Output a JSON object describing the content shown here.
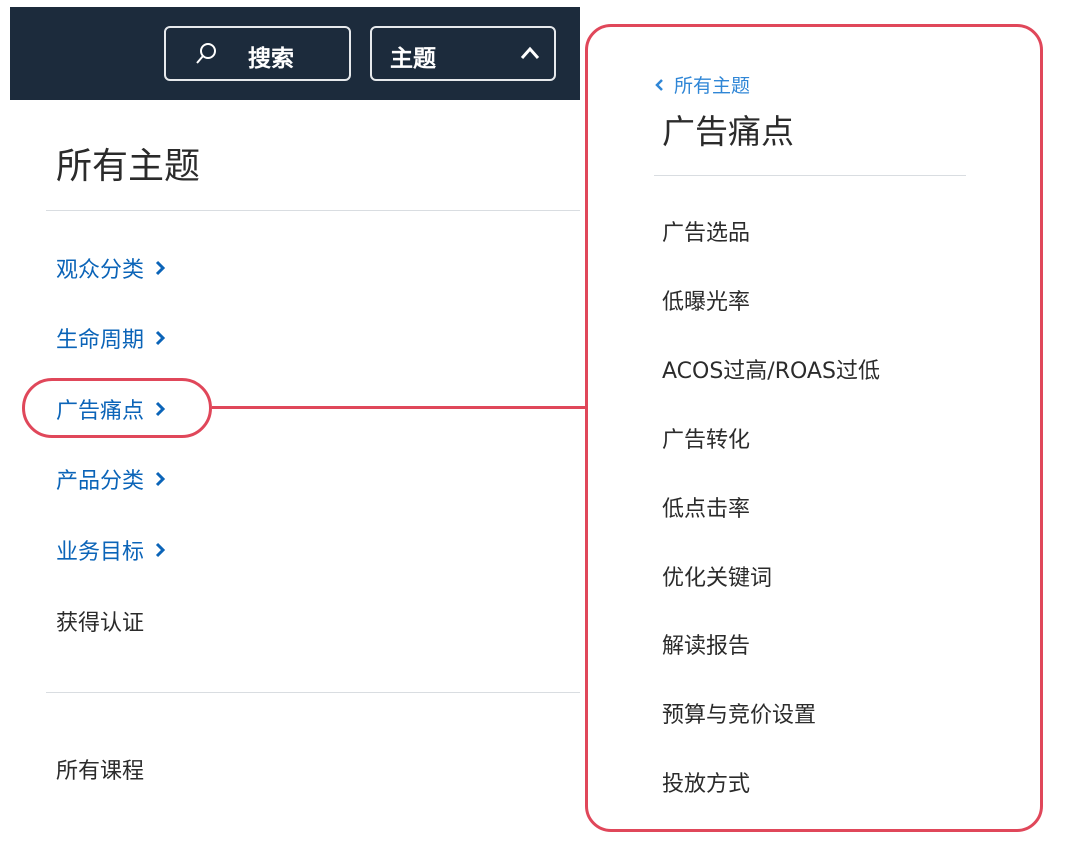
{
  "header": {
    "search_label": "搜索",
    "topic_label": "主题"
  },
  "left": {
    "title": "所有主题",
    "nav": [
      {
        "label": "观众分类"
      },
      {
        "label": "生命周期"
      },
      {
        "label": "广告痛点"
      },
      {
        "label": "产品分类"
      },
      {
        "label": "业务目标"
      }
    ],
    "certification": "获得认证",
    "all_courses": "所有课程"
  },
  "panel": {
    "back_label": "所有主题",
    "title": "广告痛点",
    "items": [
      {
        "label": "广告选品"
      },
      {
        "label": "低曝光率"
      },
      {
        "label": "ACOS过高/ROAS过低"
      },
      {
        "label": "广告转化"
      },
      {
        "label": "低点击率"
      },
      {
        "label": "优化关键词"
      },
      {
        "label": "解读报告"
      },
      {
        "label": "预算与竞价设置"
      },
      {
        "label": "投放方式"
      }
    ]
  },
  "colors": {
    "header_bg": "#1c2b3c",
    "link_blue": "#0b64b8",
    "highlight_red": "#e0475a"
  }
}
